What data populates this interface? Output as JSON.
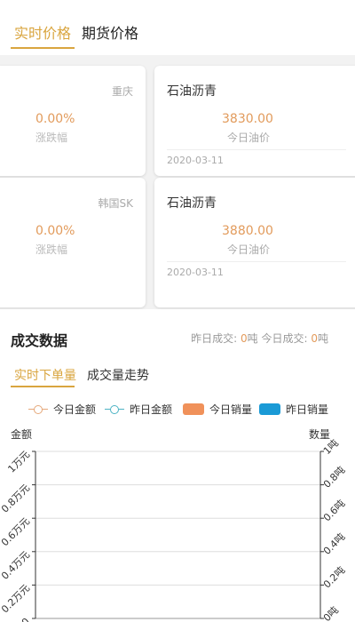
{
  "tabs": {
    "realtime": "实时价格",
    "futures": "期货价格"
  },
  "cards": [
    {
      "location": "重庆",
      "percent": "0.00%",
      "percent_label": "涨跌幅"
    },
    {
      "location": "韩国SK",
      "percent": "0.00%",
      "percent_label": "涨跌幅"
    }
  ],
  "prices": [
    {
      "name": "石油沥青",
      "price": "3830.00",
      "price_label": "今日油价",
      "date": "2020-03-11"
    },
    {
      "name": "石油沥青",
      "price": "3880.00",
      "price_label": "今日油价",
      "date": "2020-03-11"
    }
  ],
  "trade": {
    "title": "成交数据",
    "yesterday_label": "昨日成交:",
    "yesterday_value": "0",
    "today_label": "今日成交:",
    "today_value": "0",
    "unit": "吨",
    "sub_tabs": [
      "实时下单量",
      "成交量走势"
    ]
  },
  "legend": [
    {
      "label": "今日金额",
      "color": "#e5a87a"
    },
    {
      "label": "昨日金额",
      "color": "#4db3c4"
    },
    {
      "label": "今日销量",
      "color": "#f0915a"
    },
    {
      "label": "昨日销量",
      "color": "#1a9ad6"
    }
  ],
  "chart_data": {
    "type": "line",
    "ylabel": "金额",
    "y2label": "数量",
    "yticks": [
      "1万元",
      "0.8万元",
      "0.6万元",
      "0.4万元",
      "0.2万元",
      "0"
    ],
    "y2ticks": [
      "1吨",
      "0.8吨",
      "0.6吨",
      "0.4吨",
      "0.2吨",
      "0吨"
    ],
    "ylim": [
      0,
      1
    ],
    "y2lim": [
      0,
      1
    ],
    "grid": true
  }
}
